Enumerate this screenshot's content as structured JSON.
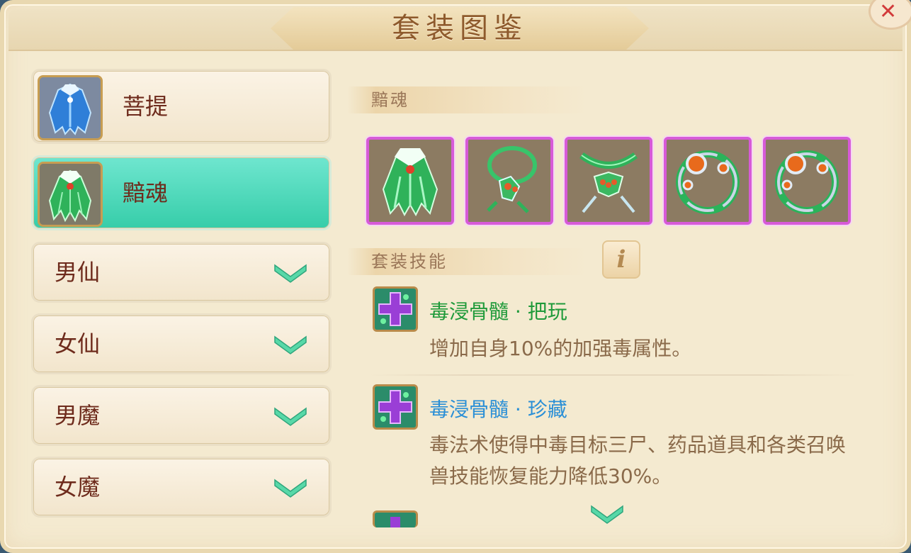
{
  "window": {
    "title": "套装图鉴"
  },
  "sets": [
    {
      "label": "菩提",
      "selected": false,
      "icon": "blue-robe-icon"
    },
    {
      "label": "黯魂",
      "selected": true,
      "icon": "green-robe-icon"
    }
  ],
  "groups": [
    {
      "label": "男仙"
    },
    {
      "label": "女仙"
    },
    {
      "label": "男魔"
    },
    {
      "label": "女魔"
    }
  ],
  "detail": {
    "set_title": "黯魂",
    "equipment": [
      {
        "icon": "green-robe-icon"
      },
      {
        "icon": "green-amulet-icon"
      },
      {
        "icon": "green-necklace-icon"
      },
      {
        "icon": "orange-gem-ring-icon"
      },
      {
        "icon": "orange-gem-ring-icon"
      }
    ],
    "skills_header": "套装技能",
    "skills": [
      {
        "name": "毒浸骨髓 · 把玩",
        "desc": "增加自身10%的加强毒属性。"
      },
      {
        "name": "毒浸骨髓 · 珍藏",
        "desc": "毒法术使得中毒目标三尸、药品道具和各类召唤兽技能恢复能力降低30%。"
      }
    ]
  },
  "colors": {
    "selected_bg": "#3fd4b0",
    "item_text": "#6e2b1c",
    "skill1_name": "#1f9a3a",
    "skill2_name": "#2a8fd6",
    "desc_text": "#8a6a4a",
    "equip_border": "#d75ad8"
  }
}
